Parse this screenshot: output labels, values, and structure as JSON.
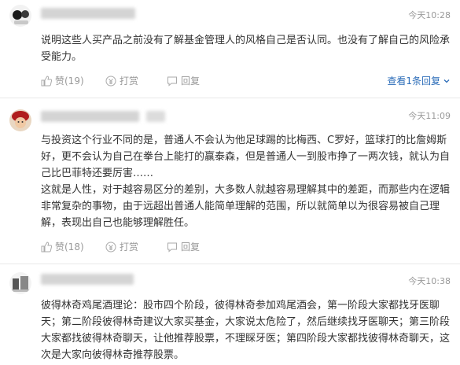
{
  "comments": [
    {
      "time": "今天10:28",
      "paragraphs": [
        "说明这些人买产品之前没有了解基金管理人的风格自己是否认同。也没有了解自己的风险承受能力。"
      ],
      "likes": "赞(19)",
      "tip": "打赏",
      "reply": "回复",
      "more_replies": "查看1条回复"
    },
    {
      "time": "今天11:09",
      "paragraphs": [
        "与投资这个行业不同的是，普通人不会认为他足球踢的比梅西、C罗好，篮球打的比詹姆斯好，更不会认为自己在拳台上能打的赢泰森，但是普通人一到股市挣了一两次钱，就认为自己比巴菲特还要厉害……",
        "这就是人性，对于越容易区分的差别，大多数人就越容易理解其中的差距，而那些内在逻辑非常复杂的事物，由于远超出普通人能简单理解的范围，所以就简单以为很容易被自己理解，表现出自己也能够理解胜任。"
      ],
      "likes": "赞(18)",
      "tip": "打赏",
      "reply": "回复"
    },
    {
      "time": "今天10:38",
      "paragraphs": [
        "彼得林奇鸡尾酒理论：股市四个阶段，彼得林奇参加鸡尾酒会，第一阶段大家都找牙医聊天；第二阶段彼得林奇建议大家买基金，大家说太危险了，然后继续找牙医聊天；第三阶段大家都找彼得林奇聊天，让他推荐股票，不理睬牙医；第四阶段大家都找彼得林奇聊天，这次是大家向彼得林奇推荐股票。"
      ]
    }
  ],
  "icons": {
    "like": "thumbs-up-icon",
    "tip": "coin-icon",
    "reply": "speech-bubble-icon",
    "expand": "chevron-down-icon"
  },
  "colors": {
    "link": "#2b6cb8",
    "meta": "#999999",
    "text": "#333333"
  }
}
